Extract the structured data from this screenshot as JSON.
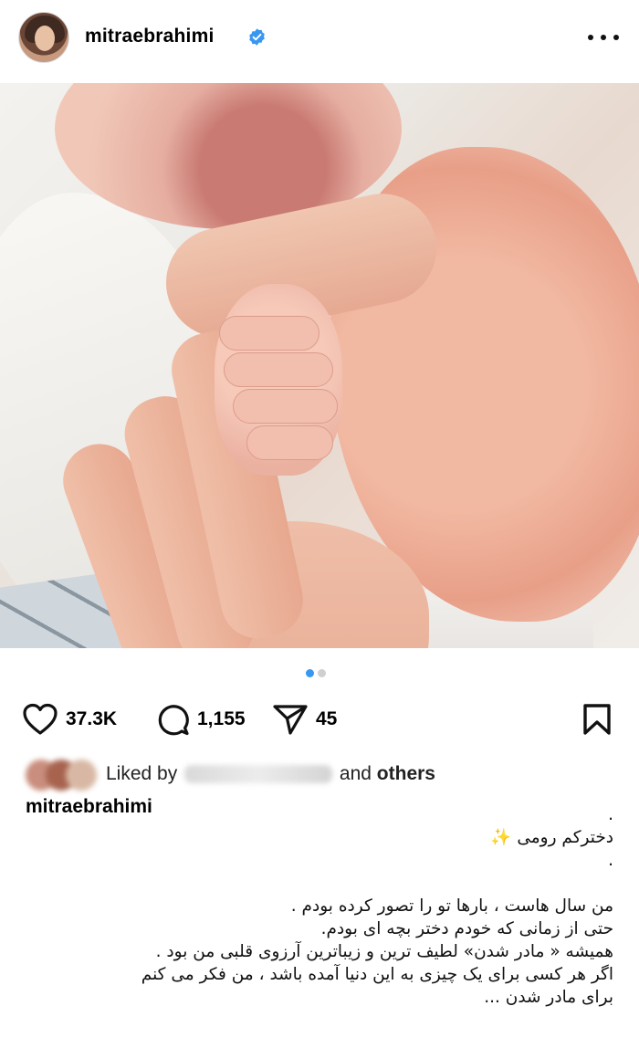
{
  "post": {
    "header": {
      "username": "mitraebrahimi",
      "verified": true,
      "more_icon": "more-horizontal-icon"
    },
    "carousel": {
      "total": 2,
      "active_index": 0
    },
    "actions": {
      "likes": "37.3K",
      "comments": "1,155",
      "shares": "45"
    },
    "liked_by": {
      "prefix": "Liked by",
      "middle": "and",
      "suffix": "others"
    },
    "caption": {
      "username": "mitraebrahimi",
      "lines": [
        ".",
        "دخترکم رومی",
        ".",
        "",
        "من سال هاست ، بارها تو را تصور کرده بودم .",
        "حتی از زمانی که خودم دختر بچه ای بودم.",
        "همیشه « مادر شدن» لطیف ترین و زیباترین آرزوی قلبی من بود .",
        "اگر هر کسی برای یک چیزی به این دنیا آمده باشد ، من فکر می کنم",
        "برای مادر شدن ..."
      ],
      "emoji": "✨"
    },
    "colors": {
      "verified": "#3897f0",
      "active_dot": "#3897f0",
      "inactive_dot": "#cfcfcf"
    }
  }
}
